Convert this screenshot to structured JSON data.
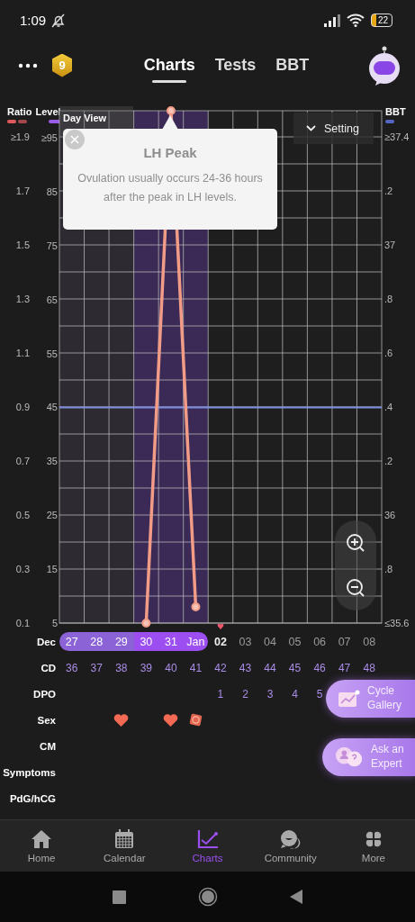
{
  "status_bar": {
    "time": "1:09",
    "battery": "22"
  },
  "header": {
    "badge": "9",
    "tabs": [
      {
        "label": "Charts",
        "selected": true
      },
      {
        "label": "Tests",
        "selected": false
      },
      {
        "label": "BBT",
        "selected": false
      }
    ]
  },
  "chart": {
    "legend": {
      "ratio": "Ratio",
      "bbt": "BBT"
    },
    "view": "Day View",
    "setting": "Setting",
    "ratio_ticks": [
      "≥1.9",
      "1.7",
      "1.5",
      "1.3",
      "1.1",
      "0.9",
      "0.7",
      "0.5",
      "0.3",
      "0.1"
    ],
    "bbt_ticks": [
      "≥37.4",
      ".2",
      "37",
      ".8",
      ".6",
      ".4",
      ".2",
      "36",
      ".8",
      "≤35.6"
    ],
    "tooltip": {
      "title": "LH Peak",
      "text": "Ovulation usually occurs 24-36 hours after the peak in LH levels."
    },
    "chart_data": {
      "type": "line",
      "categories": [
        "27",
        "28",
        "29",
        "30",
        "31",
        "Jan",
        "02",
        "03",
        "04",
        "05",
        "06",
        "07",
        "08"
      ],
      "grid": true,
      "bands": [
        {
          "axis": "x",
          "from": "27",
          "to": "29",
          "color": "#2e2a32"
        },
        {
          "axis": "x",
          "from": "30",
          "to": "Jan",
          "color": "#3a2a55"
        }
      ],
      "ref_lines": [
        {
          "axis": "y",
          "value": 45,
          "color": "#7f8fe0"
        }
      ],
      "series": [
        {
          "name": "Level",
          "color": "#f29c88",
          "marker": "o",
          "values": [
            null,
            null,
            null,
            5,
            100,
            8,
            null,
            null,
            null,
            null,
            null,
            null,
            null
          ]
        }
      ],
      "ylim": [
        5,
        100
      ],
      "yticks": [
        {
          "value": 95,
          "label": "≥95"
        },
        {
          "value": 85,
          "label": "85"
        },
        {
          "value": 75,
          "label": "75"
        },
        {
          "value": 65,
          "label": "65"
        },
        {
          "value": 55,
          "label": "55"
        },
        {
          "value": 45,
          "label": "45"
        },
        {
          "value": 35,
          "label": "35"
        },
        {
          "value": 25,
          "label": "25"
        },
        {
          "value": 15,
          "label": "15"
        },
        {
          "value": 5,
          "label": "5"
        }
      ]
    }
  },
  "rows": {
    "labels": [
      "Dec",
      "CD",
      "DPO",
      "Sex",
      "CM",
      "Symptoms",
      "PdG/hCG"
    ],
    "days": [
      {
        "cd": "36",
        "fertile": true,
        "peak": false,
        "today": false,
        "intercourse": false,
        "protected": false
      },
      {
        "cd": "37",
        "fertile": true,
        "peak": false,
        "today": false,
        "intercourse": false,
        "protected": false
      },
      {
        "cd": "38",
        "fertile": true,
        "peak": false,
        "today": false,
        "intercourse": true,
        "protected": false
      },
      {
        "cd": "39",
        "fertile": false,
        "peak": true,
        "today": false,
        "intercourse": false,
        "protected": false
      },
      {
        "cd": "40",
        "fertile": false,
        "peak": true,
        "today": false,
        "intercourse": true,
        "protected": false
      },
      {
        "cd": "41",
        "fertile": false,
        "peak": true,
        "today": false,
        "intercourse": false,
        "protected": true
      },
      {
        "cd": "42",
        "dpo": "1",
        "fertile": false,
        "peak": false,
        "today": true,
        "intercourse": false,
        "protected": false
      },
      {
        "cd": "43",
        "dpo": "2",
        "fertile": false,
        "peak": false,
        "today": false,
        "intercourse": false,
        "protected": false
      },
      {
        "cd": "44",
        "dpo": "3",
        "fertile": false,
        "peak": false,
        "today": false,
        "intercourse": false,
        "protected": false
      },
      {
        "cd": "45",
        "dpo": "4",
        "fertile": false,
        "peak": false,
        "today": false,
        "intercourse": false,
        "protected": false
      },
      {
        "cd": "46",
        "dpo": "5",
        "fertile": false,
        "peak": false,
        "today": false,
        "intercourse": false,
        "protected": false
      },
      {
        "cd": "47",
        "fertile": false,
        "peak": false,
        "today": false,
        "intercourse": false,
        "protected": false
      },
      {
        "cd": "48",
        "fertile": false,
        "peak": false,
        "today": false,
        "intercourse": false,
        "protected": false
      }
    ]
  },
  "floating_buttons": [
    {
      "label": "Cycle Gallery",
      "kind": "gallery"
    },
    {
      "label": "Ask an Expert",
      "kind": "expert"
    }
  ],
  "nav": [
    {
      "label": "Home",
      "kind": "home",
      "selected": false
    },
    {
      "label": "Calendar",
      "kind": "calendar",
      "selected": false
    },
    {
      "label": "Charts",
      "kind": "charts",
      "selected": true
    },
    {
      "label": "Community",
      "kind": "community",
      "selected": false
    },
    {
      "label": "More",
      "kind": "more",
      "selected": false
    }
  ]
}
